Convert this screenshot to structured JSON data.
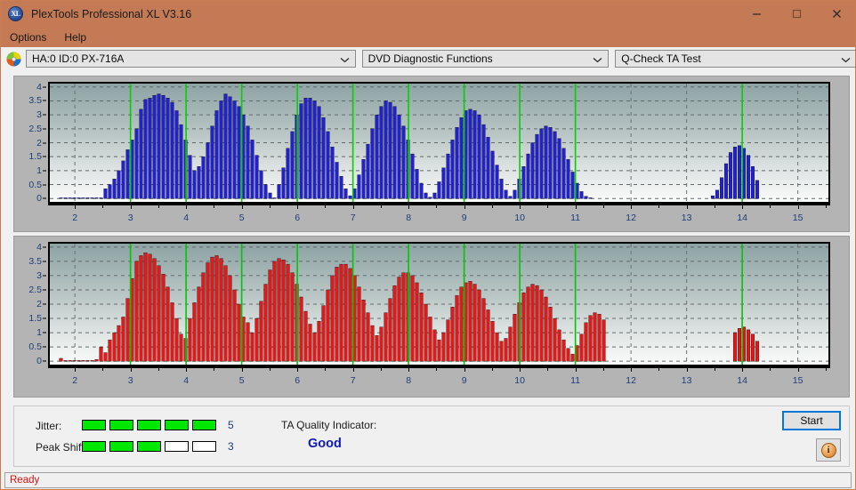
{
  "window": {
    "title": "PlexTools Professional XL V3.16",
    "logo_text": "XL",
    "logo_icon": "plextools-logo-icon",
    "minimize_icon": "minimize-icon",
    "maximize_icon": "maximize-icon",
    "close_icon": "close-icon"
  },
  "menu": {
    "items": [
      {
        "label": "Options"
      },
      {
        "label": "Help"
      }
    ]
  },
  "toolbar": {
    "drive_icon": "optical-disc-icon",
    "drive": {
      "value": "HA:0 ID:0  PX-716A",
      "chevron": "chevron-down-icon"
    },
    "function": {
      "value": "DVD Diagnostic Functions",
      "chevron": "chevron-down-icon"
    },
    "test": {
      "value": "Q-Check TA Test",
      "chevron": "chevron-down-icon"
    }
  },
  "results": {
    "jitter": {
      "label": "Jitter:",
      "value": "5",
      "filled": 5,
      "total": 5
    },
    "peak_shift": {
      "label": "Peak Shift:",
      "value": "3",
      "filled": 3,
      "total": 5
    },
    "ta_quality": {
      "label": "TA Quality Indicator:",
      "value": "Good",
      "color": "#0d1cb4"
    },
    "start_button": "Start",
    "info_button_icon": "info-icon"
  },
  "statusbar": {
    "text": "Ready",
    "color": "#d61414"
  },
  "chart_data": [
    {
      "id": "ta-jitter-chart",
      "type": "bar",
      "title": "",
      "xlabel": "",
      "ylabel": "",
      "series_color": "#1414d2",
      "bar_color": "#2020d8",
      "marker_color": "#00d200",
      "grid": true,
      "xlim": [
        1.55,
        15.55
      ],
      "ylim": [
        -0.12,
        4.12
      ],
      "xticks": [
        2,
        3,
        4,
        5,
        6,
        7,
        8,
        9,
        10,
        11,
        12,
        13,
        14,
        15
      ],
      "xticklabels": [
        "2",
        "3",
        "4",
        "5",
        "6",
        "7",
        "8",
        "9",
        "10",
        "11",
        "12",
        "13",
        "14",
        "15"
      ],
      "yticks": [
        0,
        0.5,
        1,
        1.5,
        2,
        2.5,
        3,
        3.5,
        4
      ],
      "yticklabels": [
        "0",
        "0.5",
        "1",
        "1.5",
        "2",
        "2.5",
        "3",
        "3.5",
        "4"
      ],
      "markers_x": [
        3,
        4,
        5,
        6,
        7,
        8,
        9,
        10,
        11,
        14
      ],
      "x": [
        1.75,
        1.83,
        1.91,
        1.99,
        2.07,
        2.15,
        2.23,
        2.31,
        2.39,
        2.47,
        2.55,
        2.63,
        2.71,
        2.79,
        2.87,
        2.95,
        3.03,
        3.11,
        3.19,
        3.27,
        3.35,
        3.43,
        3.51,
        3.59,
        3.67,
        3.75,
        3.83,
        3.91,
        3.99,
        4.07,
        4.15,
        4.23,
        4.31,
        4.39,
        4.47,
        4.55,
        4.63,
        4.71,
        4.79,
        4.87,
        4.95,
        5.03,
        5.11,
        5.19,
        5.27,
        5.35,
        5.43,
        5.51,
        5.59,
        5.67,
        5.75,
        5.83,
        5.91,
        5.99,
        6.07,
        6.15,
        6.23,
        6.31,
        6.39,
        6.47,
        6.55,
        6.63,
        6.71,
        6.79,
        6.87,
        6.95,
        7.03,
        7.11,
        7.19,
        7.27,
        7.35,
        7.43,
        7.51,
        7.59,
        7.67,
        7.75,
        7.83,
        7.91,
        7.99,
        8.07,
        8.15,
        8.23,
        8.31,
        8.39,
        8.47,
        8.55,
        8.63,
        8.71,
        8.79,
        8.87,
        8.95,
        9.03,
        9.11,
        9.19,
        9.27,
        9.35,
        9.43,
        9.51,
        9.59,
        9.67,
        9.75,
        9.83,
        9.91,
        9.99,
        10.07,
        10.15,
        10.23,
        10.31,
        10.39,
        10.47,
        10.55,
        10.63,
        10.71,
        10.79,
        10.87,
        10.95,
        11.03,
        11.11,
        11.19,
        11.27,
        13.47,
        13.55,
        13.63,
        13.71,
        13.79,
        13.87,
        13.95,
        14.03,
        14.11,
        14.19,
        14.27
      ],
      "values": [
        0,
        0,
        0,
        0,
        0,
        0,
        0,
        0,
        0,
        0,
        0.35,
        0.5,
        0.7,
        1.0,
        1.35,
        1.75,
        2.1,
        2.5,
        3.2,
        3.55,
        3.6,
        3.7,
        3.75,
        3.7,
        3.6,
        3.45,
        3.15,
        2.65,
        2.1,
        1.55,
        1.0,
        1.15,
        1.5,
        2.0,
        2.6,
        3.15,
        3.5,
        3.75,
        3.65,
        3.5,
        3.3,
        3.0,
        2.6,
        2.1,
        1.55,
        1.0,
        0.5,
        0.2,
        0,
        0.5,
        1.1,
        1.8,
        2.4,
        3.0,
        3.4,
        3.6,
        3.6,
        3.5,
        3.3,
        2.9,
        2.4,
        1.85,
        1.3,
        0.8,
        0.35,
        0.1,
        0.35,
        0.85,
        1.4,
        1.95,
        2.5,
        3.0,
        3.3,
        3.5,
        3.45,
        3.3,
        3.0,
        2.6,
        2.1,
        1.6,
        1.05,
        0.55,
        0.2,
        0.05,
        0.2,
        0.6,
        1.1,
        1.6,
        2.1,
        2.55,
        2.9,
        3.15,
        3.2,
        3.15,
        3.0,
        2.65,
        2.2,
        1.7,
        1.2,
        0.7,
        0.3,
        0.08,
        0.3,
        0.7,
        1.15,
        1.6,
        2.0,
        2.3,
        2.5,
        2.6,
        2.55,
        2.4,
        2.15,
        1.8,
        1.4,
        0.95,
        0.55,
        0.25,
        0.08,
        0.02,
        0.1,
        0.3,
        0.75,
        1.25,
        1.65,
        1.85,
        1.9,
        1.8,
        1.55,
        1.15,
        0.65
      ]
    },
    {
      "id": "ta-peak-shift-chart",
      "type": "bar",
      "title": "",
      "xlabel": "",
      "ylabel": "",
      "series_color": "#e81414",
      "bar_color": "#ef1414",
      "marker_color": "#00c800",
      "grid": true,
      "xlim": [
        1.55,
        15.55
      ],
      "ylim": [
        -0.12,
        4.12
      ],
      "xticks": [
        2,
        3,
        4,
        5,
        6,
        7,
        8,
        9,
        10,
        11,
        12,
        13,
        14,
        15
      ],
      "xticklabels": [
        "2",
        "3",
        "4",
        "5",
        "6",
        "7",
        "8",
        "9",
        "10",
        "11",
        "12",
        "13",
        "14",
        "15"
      ],
      "yticks": [
        0,
        0.5,
        1,
        1.5,
        2,
        2.5,
        3,
        3.5,
        4
      ],
      "yticklabels": [
        "0",
        "0.5",
        "1",
        "1.5",
        "2",
        "2.5",
        "3",
        "3.5",
        "4"
      ],
      "markers_x": [
        3,
        4,
        5,
        6,
        7,
        8,
        9,
        10,
        11,
        14
      ],
      "x": [
        1.75,
        1.83,
        1.91,
        1.99,
        2.07,
        2.15,
        2.23,
        2.31,
        2.39,
        2.47,
        2.55,
        2.63,
        2.71,
        2.79,
        2.87,
        2.95,
        3.03,
        3.11,
        3.19,
        3.27,
        3.35,
        3.43,
        3.51,
        3.59,
        3.67,
        3.75,
        3.83,
        3.91,
        3.99,
        4.07,
        4.15,
        4.23,
        4.31,
        4.39,
        4.47,
        4.55,
        4.63,
        4.71,
        4.79,
        4.87,
        4.95,
        5.03,
        5.11,
        5.19,
        5.27,
        5.35,
        5.43,
        5.51,
        5.59,
        5.67,
        5.75,
        5.83,
        5.91,
        5.99,
        6.07,
        6.15,
        6.23,
        6.31,
        6.39,
        6.47,
        6.55,
        6.63,
        6.71,
        6.79,
        6.87,
        6.95,
        7.03,
        7.11,
        7.19,
        7.27,
        7.35,
        7.43,
        7.51,
        7.59,
        7.67,
        7.75,
        7.83,
        7.91,
        7.99,
        8.07,
        8.15,
        8.23,
        8.31,
        8.39,
        8.47,
        8.55,
        8.63,
        8.71,
        8.79,
        8.87,
        8.95,
        9.03,
        9.11,
        9.19,
        9.27,
        9.35,
        9.43,
        9.51,
        9.59,
        9.67,
        9.75,
        9.83,
        9.91,
        9.99,
        10.07,
        10.15,
        10.23,
        10.31,
        10.39,
        10.47,
        10.55,
        10.63,
        10.71,
        10.79,
        10.87,
        10.95,
        11.03,
        11.11,
        11.19,
        11.27,
        11.35,
        11.43,
        11.51,
        13.87,
        13.95,
        14.03,
        14.11,
        14.19,
        14.27
      ],
      "values": [
        0.1,
        0,
        0,
        0,
        0,
        0,
        0,
        0,
        0.06,
        0.5,
        0.3,
        0.75,
        1.0,
        1.25,
        1.55,
        2.2,
        2.9,
        3.5,
        3.7,
        3.8,
        3.75,
        3.6,
        3.35,
        3.05,
        2.6,
        2.05,
        1.5,
        0.95,
        0.8,
        1.5,
        2.05,
        2.6,
        3.1,
        3.45,
        3.65,
        3.7,
        3.6,
        3.35,
        3.0,
        2.5,
        2.0,
        1.55,
        1.35,
        1.0,
        1.5,
        2.1,
        2.7,
        3.2,
        3.5,
        3.6,
        3.55,
        3.4,
        3.1,
        2.7,
        2.25,
        1.75,
        1.3,
        1.0,
        1.4,
        1.95,
        2.5,
        3.0,
        3.3,
        3.4,
        3.4,
        3.25,
        3.0,
        2.6,
        2.15,
        1.7,
        1.25,
        0.9,
        1.2,
        1.7,
        2.2,
        2.65,
        2.95,
        3.1,
        3.1,
        3.0,
        2.75,
        2.4,
        2.0,
        1.55,
        1.1,
        0.75,
        1.0,
        1.45,
        1.9,
        2.3,
        2.6,
        2.75,
        2.8,
        2.7,
        2.5,
        2.2,
        1.8,
        1.4,
        1.0,
        0.7,
        0.8,
        1.2,
        1.65,
        2.05,
        2.4,
        2.6,
        2.7,
        2.65,
        2.5,
        2.25,
        1.9,
        1.5,
        1.1,
        0.75,
        0.45,
        0.25,
        0.55,
        0.95,
        1.35,
        1.6,
        1.7,
        1.65,
        1.45,
        1.0,
        1.15,
        1.2,
        1.1,
        0.95,
        0.7
      ]
    }
  ]
}
